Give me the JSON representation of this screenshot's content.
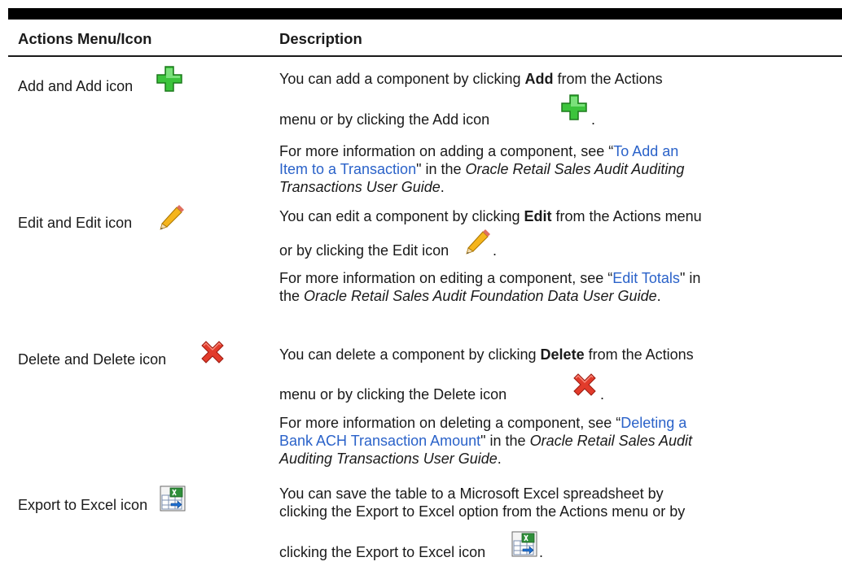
{
  "table": {
    "header": {
      "col1": "Actions Menu/Icon",
      "col2": "Description"
    },
    "rows": [
      {
        "name": "Add and Add icon",
        "icon": "add-icon",
        "desc1_a": "You can add a component by clicking ",
        "desc1_b": "Add",
        "desc1_c": " from the Actions",
        "desc1_d": "menu or by clicking the Add icon",
        "desc1_e": ".",
        "more_a": "For more information on adding a component, see “",
        "more_link1": "To Add an",
        "more_link2": "Item to a Transaction",
        "more_b": "\" in the ",
        "more_it1": "Oracle Retail Sales Audit Auditing",
        "more_it2": "Transactions User Guide",
        "more_c": "."
      },
      {
        "name": "Edit and Edit icon",
        "icon": "edit-pencil-icon",
        "desc1_a": "You can edit a component by clicking ",
        "desc1_b": "Edit",
        "desc1_c": " from the Actions menu",
        "desc1_d": "or by clicking the Edit icon",
        "desc1_e": ".",
        "more_a": "For more information on editing a component, see “",
        "more_link1": "Edit Totals",
        "more_b": "\" in",
        "more_c": "the ",
        "more_it1": "Oracle Retail Sales Audit Foundation Data User Guide",
        "more_d": "."
      },
      {
        "name": "Delete and Delete icon",
        "icon": "delete-x-icon",
        "desc1_a": "You can delete a component by clicking ",
        "desc1_b": "Delete",
        "desc1_c": " from the Actions",
        "desc1_d": "menu or by clicking the Delete icon",
        "desc1_e": ".",
        "more_a": "For more information on deleting a component, see “",
        "more_link1": "Deleting a",
        "more_link2": "Bank ACH Transaction Amount",
        "more_b": "\" in the ",
        "more_it1": "Oracle Retail Sales Audit",
        "more_it2": "Auditing Transactions User Guide",
        "more_c": "."
      },
      {
        "name": "Export to Excel icon",
        "icon": "export-excel-icon",
        "desc1": "You can save the table to a Microsoft Excel spreadsheet by",
        "desc2": "clicking the Export to Excel option from the Actions menu or by",
        "desc3": "clicking the Export to Excel icon",
        "desc3_end": "."
      }
    ]
  }
}
